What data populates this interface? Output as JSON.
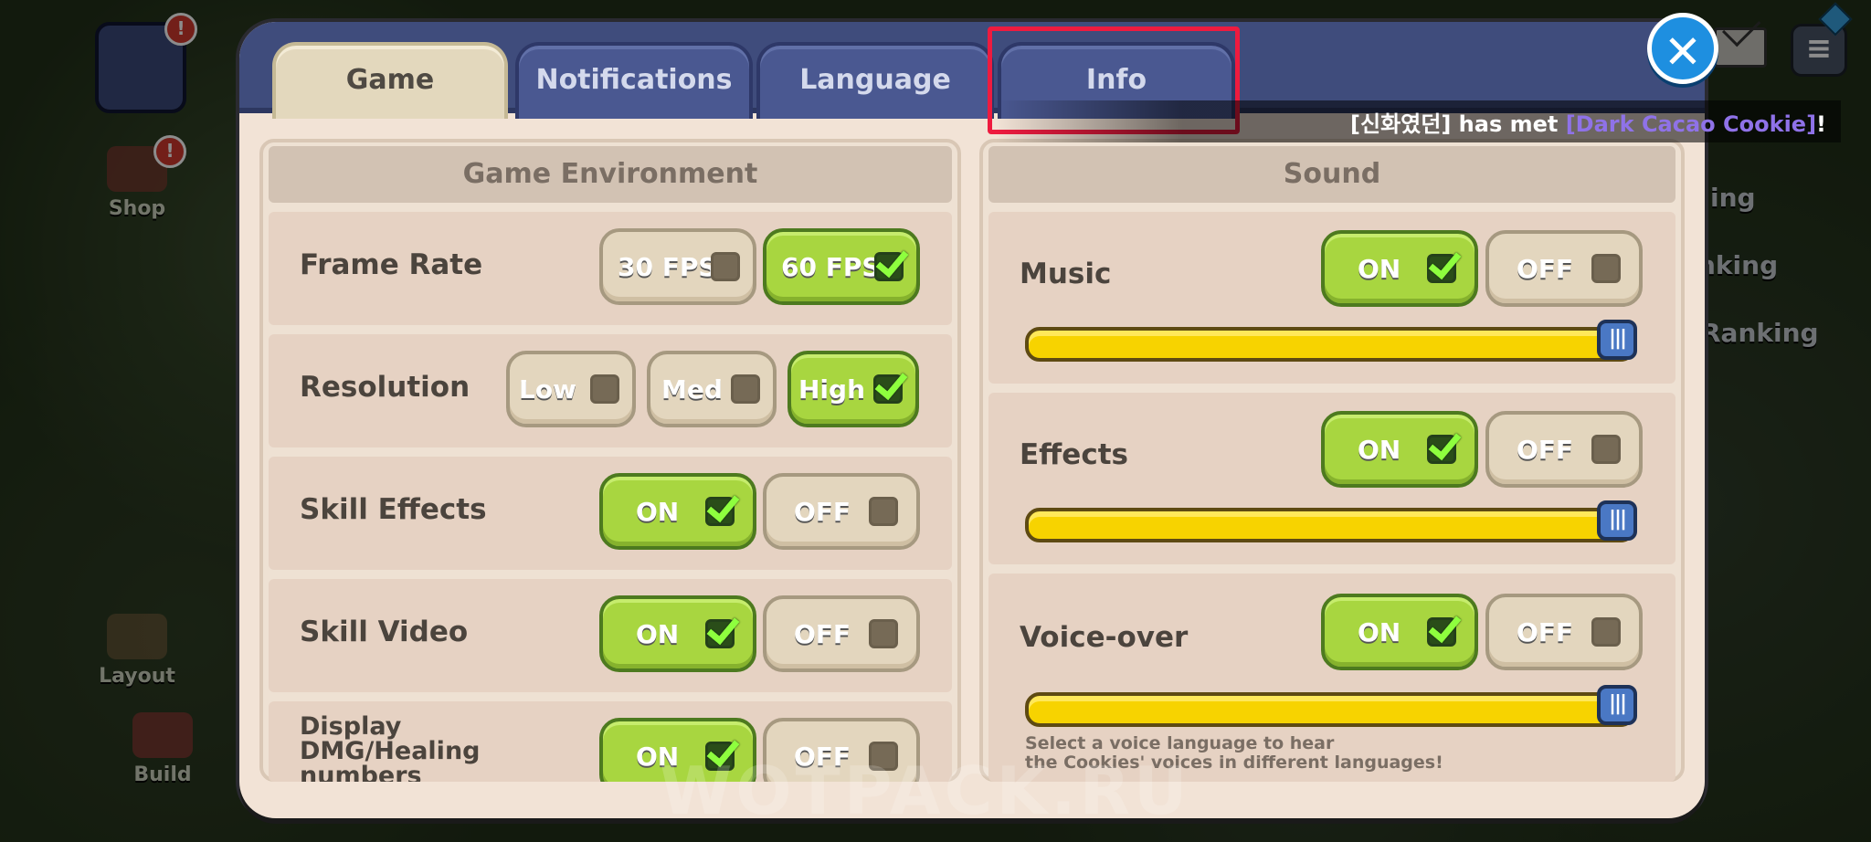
{
  "hud": {
    "badge_mark": "!",
    "shop_label": "Shop",
    "layout_label": "Layout",
    "build_label": "Build",
    "right_items": [
      "ing",
      "nking",
      "Ranking"
    ]
  },
  "ticker": {
    "prefix": "[신화였던] has met ",
    "highlight": "[Dark Cacao Cookie]",
    "suffix": "!"
  },
  "dialog": {
    "tabs": [
      {
        "label": "Game",
        "active": true
      },
      {
        "label": "Notifications",
        "active": false
      },
      {
        "label": "Language",
        "active": false
      },
      {
        "label": "Info",
        "active": false,
        "highlighted": true
      }
    ],
    "close_icon": "close-icon"
  },
  "game_environment": {
    "title": "Game Environment",
    "rows": [
      {
        "label": "Frame Rate",
        "options": [
          {
            "text": "30 FPS",
            "selected": false
          },
          {
            "text": "60 FPS",
            "selected": true
          }
        ]
      },
      {
        "label": "Resolution",
        "options": [
          {
            "text": "Low",
            "selected": false
          },
          {
            "text": "Med",
            "selected": false
          },
          {
            "text": "High",
            "selected": true
          }
        ]
      },
      {
        "label": "Skill Effects",
        "options": [
          {
            "text": "ON",
            "selected": true
          },
          {
            "text": "OFF",
            "selected": false
          }
        ]
      },
      {
        "label": "Skill Video",
        "options": [
          {
            "text": "ON",
            "selected": true
          },
          {
            "text": "OFF",
            "selected": false
          }
        ]
      },
      {
        "label": "Display DMG/Healing numbers",
        "options": [
          {
            "text": "ON",
            "selected": true
          },
          {
            "text": "OFF",
            "selected": false
          }
        ]
      }
    ]
  },
  "sound": {
    "title": "Sound",
    "rows": [
      {
        "label": "Music",
        "on": "ON",
        "off": "OFF",
        "enabled": true,
        "volume": 1.0
      },
      {
        "label": "Effects",
        "on": "ON",
        "off": "OFF",
        "enabled": true,
        "volume": 1.0
      },
      {
        "label": "Voice-over",
        "on": "ON",
        "off": "OFF",
        "enabled": true,
        "volume": 1.0
      }
    ],
    "voice_hint_line1": "Select a voice language to hear",
    "voice_hint_line2": "the Cookies' voices in different languages!"
  },
  "watermark": "WOTPACK.RU",
  "colors": {
    "tab_highlight": "#ee1b3f",
    "on_green": "#a8d640",
    "slider_yellow": "#f7d300"
  }
}
